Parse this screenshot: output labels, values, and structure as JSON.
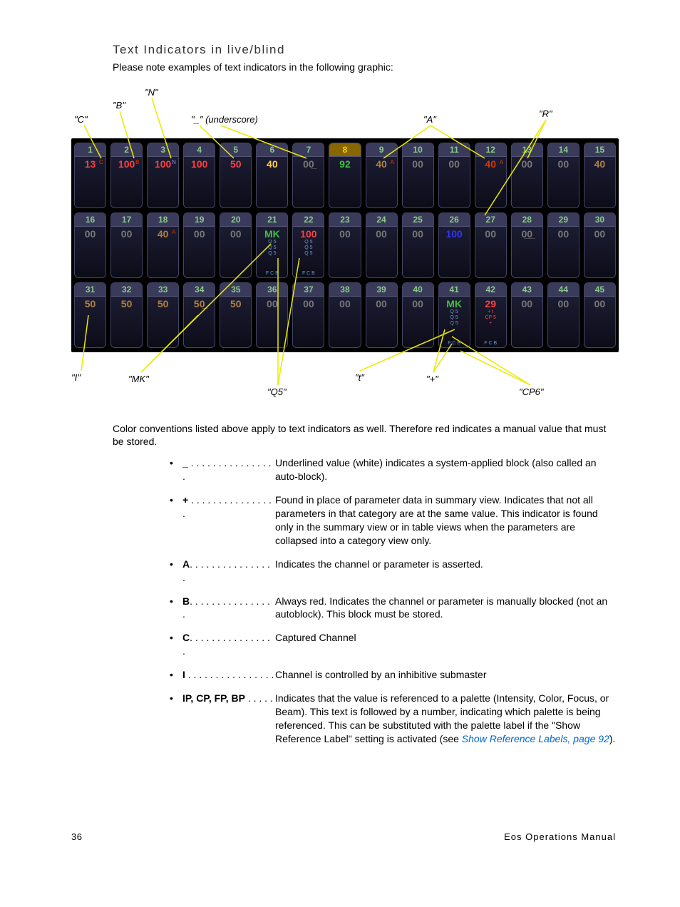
{
  "heading": "Text Indicators in live/blind",
  "intro": "Please note examples of text indicators in the following graphic:",
  "callouts": {
    "c": "\"C\"",
    "b": "\"B\"",
    "n": "\"N\"",
    "underscore": "\"_\" (underscore)",
    "a": "\"A\"",
    "r": "\"R\"",
    "i": "\"I\"",
    "mk": "\"MK\"",
    "q5": "\"Q5\"",
    "t": "\"t\"",
    "plus": "\"+\"",
    "cp6": "\"CP6\""
  },
  "grid": {
    "rows": [
      [
        {
          "n": "1",
          "v": "13",
          "vc": "#ff4040",
          "badge": "C",
          "bc": "#dd3300",
          "bx": "34"
        },
        {
          "n": "2",
          "v": "100",
          "vc": "#ff4040",
          "badge": "B",
          "bc": "#dd3300",
          "bx": "34"
        },
        {
          "n": "3",
          "v": "100",
          "vc": "#ff4040",
          "badge": "N",
          "bc": "#8888dd",
          "bx": "34"
        },
        {
          "n": "4",
          "v": "100",
          "vc": "#ff4040"
        },
        {
          "n": "5",
          "v": "50",
          "vc": "#ff4040"
        },
        {
          "n": "6",
          "v": "40",
          "vc": "#ffd040"
        },
        {
          "n": "7",
          "v": "00̲",
          "vc": "#777"
        },
        {
          "n": "8",
          "v": "92",
          "vc": "#40c040",
          "nc": "#ffd000",
          "nbg": "#886600"
        },
        {
          "n": "9",
          "v": "40",
          "vc": "#b08040",
          "badge": "A",
          "bc": "#dd3300",
          "bx": "34"
        },
        {
          "n": "10",
          "v": "00",
          "vc": "#777"
        },
        {
          "n": "11",
          "v": "00",
          "vc": "#777"
        },
        {
          "n": "12",
          "v": "40",
          "vc": "#dd3300",
          "badge": "A",
          "bc": "#dd3300",
          "bx": "34"
        },
        {
          "n": "13",
          "v": "00",
          "vc": "#777"
        },
        {
          "n": "14",
          "v": "00",
          "vc": "#777"
        },
        {
          "n": "15",
          "v": "40",
          "vc": "#b08040"
        }
      ],
      [
        {
          "n": "16",
          "v": "00",
          "vc": "#777"
        },
        {
          "n": "17",
          "v": "00",
          "vc": "#777"
        },
        {
          "n": "18",
          "v": "40",
          "vc": "#b08040",
          "badge": "A",
          "bc": "#dd3300",
          "bx": "34"
        },
        {
          "n": "19",
          "v": "00",
          "vc": "#777"
        },
        {
          "n": "20",
          "v": "00",
          "vc": "#777"
        },
        {
          "n": "21",
          "v": "MK",
          "vc": "#40c040",
          "sub": "Q 5\nQ 5\nQ 5",
          "subc": "#6699cc",
          "foot": "F C B",
          "footc": "#6699cc"
        },
        {
          "n": "22",
          "v": "100",
          "vc": "#ff4040",
          "sub": "Q 5\nQ 5\nQ 5",
          "subc": "#6699cc",
          "foot": "F C B",
          "footc": "#6699cc"
        },
        {
          "n": "23",
          "v": "00",
          "vc": "#777"
        },
        {
          "n": "24",
          "v": "00",
          "vc": "#777"
        },
        {
          "n": "25",
          "v": "00",
          "vc": "#777"
        },
        {
          "n": "26",
          "v": "100",
          "vc": "#3333ff"
        },
        {
          "n": "27",
          "v": "00",
          "vc": "#777"
        },
        {
          "n": "28",
          "v": "0̲0̲",
          "vc": "#777"
        },
        {
          "n": "29",
          "v": "00",
          "vc": "#777"
        },
        {
          "n": "30",
          "v": "00",
          "vc": "#777"
        }
      ],
      [
        {
          "n": "31",
          "v": "50",
          "vc": "#b08040"
        },
        {
          "n": "32",
          "v": "50",
          "vc": "#b08040"
        },
        {
          "n": "33",
          "v": "50",
          "vc": "#b08040"
        },
        {
          "n": "34",
          "v": "50̲",
          "vc": "#b08040"
        },
        {
          "n": "35",
          "v": "50",
          "vc": "#b08040"
        },
        {
          "n": "36",
          "v": "00",
          "vc": "#777"
        },
        {
          "n": "37",
          "v": "00",
          "vc": "#777"
        },
        {
          "n": "38",
          "v": "00",
          "vc": "#777"
        },
        {
          "n": "39",
          "v": "00",
          "vc": "#777"
        },
        {
          "n": "40",
          "v": "00",
          "vc": "#777"
        },
        {
          "n": "41",
          "v": "MK",
          "vc": "#40c040",
          "sub": "Q 5\nQ 5\nQ 5",
          "subc": "#6699cc",
          "foot": "F C B",
          "footc": "#6699cc"
        },
        {
          "n": "42",
          "v": "29",
          "vc": "#ff4040",
          "sub": "+  t\nCP 5\n+",
          "subc": "#ff4040",
          "foot": "F C B",
          "footc": "#6699cc"
        },
        {
          "n": "43",
          "v": "00",
          "vc": "#777"
        },
        {
          "n": "44",
          "v": "00",
          "vc": "#777"
        },
        {
          "n": "45",
          "v": "00",
          "vc": "#777"
        }
      ]
    ]
  },
  "body_text": "Color conventions listed above apply to text indicators as well. Therefore red indicates a manual value that must be stored.",
  "definitions": [
    {
      "term": "_",
      "dots": " . . . . . . . . . . . . . . . .",
      "desc": "Underlined value (white) indicates a system-applied block (also called an auto-block)."
    },
    {
      "term": "+",
      "dots": " . . . . . . . . . . . . . . . .",
      "desc": "Found in place of parameter data in summary view. Indicates that not all parameters in that category are at the same value. This indicator is found only in the summary view or in table views when the parameters are collapsed into a category view only."
    },
    {
      "term": "A",
      "dots": ". . . . . . . . . . . . . . . .",
      "desc": "Indicates the channel or parameter is asserted."
    },
    {
      "term": "B",
      "dots": ". . . . . . . . . . . . . . . .",
      "desc": "Always red. Indicates the channel or parameter is manually blocked (not an autoblock). This block must be stored."
    },
    {
      "term": "C",
      "dots": ". . . . . . . . . . . . . . . .",
      "desc": "Captured Channel"
    },
    {
      "term": "I",
      "dots": " . . . . . . . . . . . . . . . .",
      "desc": "Channel is controlled by an inhibitive submaster"
    },
    {
      "term": "IP, CP, FP, BP",
      "dots": " . . . . .",
      "desc": "Indicates that the value is referenced to a palette (Intensity, Color, Focus, or Beam). This text is followed by a number, indicating which palette is being referenced. This can be substituted with the palette label if the \"Show Reference Label\" setting is activated (see ",
      "link": "Show Reference Labels, page 92",
      "tail": ")."
    }
  ],
  "footer": {
    "page": "36",
    "title": "Eos Operations Manual"
  }
}
